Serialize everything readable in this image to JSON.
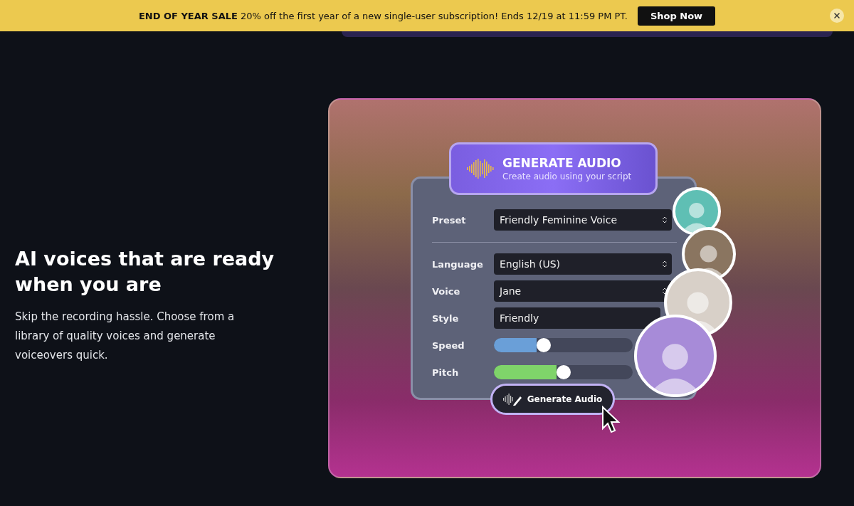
{
  "banner": {
    "text": "**END OF YEAR SALE** 20% off the first year of a new single-user subscription! Ends 12/19 at 11:59 PM PT.",
    "button": "Shop Now"
  },
  "feature": {
    "heading": "AI voices that are ready when you are",
    "body": "Skip the recording hassle. Choose from a library of quality voices and generate voiceovers quick."
  },
  "mockup": {
    "title": "GENERATE AUDIO",
    "subtitle": "Create audio using your script",
    "fields": [
      {
        "kind": "select",
        "label": "Preset",
        "value": "Friendly Feminine Voice"
      },
      {
        "kind": "divider"
      },
      {
        "kind": "select",
        "label": "Language",
        "value": "English (US)"
      },
      {
        "kind": "select",
        "label": "Voice",
        "value": "Jane"
      },
      {
        "kind": "text",
        "label": "Style",
        "value": "Friendly"
      },
      {
        "kind": "slider",
        "label": "Speed",
        "level": 0.31,
        "color": "#6a9fd8"
      },
      {
        "kind": "slider",
        "label": "Pitch",
        "level": 0.45,
        "color": "#7fd46a"
      }
    ],
    "button": "Generate Audio",
    "avatars": [
      {
        "color": "#5fbfb4"
      },
      {
        "color": "#8a7560"
      },
      {
        "color": "#d8d0c8"
      },
      {
        "color": "#a78bd8"
      }
    ]
  }
}
